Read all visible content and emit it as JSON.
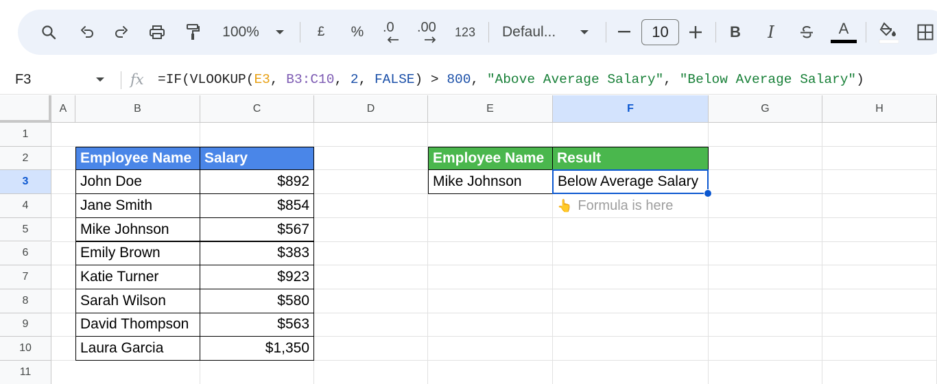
{
  "toolbar": {
    "zoom": "100%",
    "currency_label": "£",
    "percent_label": "%",
    "decrease_decimal_label": ".0",
    "increase_decimal_label": ".00",
    "more_formats_label": "123",
    "font_name": "Defaul...",
    "font_size": "10",
    "bold_label": "B",
    "italic_label": "I",
    "text_color_label": "A",
    "icons": [
      "search-icon",
      "undo-icon",
      "redo-icon",
      "print-icon",
      "paint-format-icon",
      "zoom-dropdown-icon",
      "font-dropdown-icon",
      "decrease-font-icon",
      "increase-font-icon",
      "strikethrough-icon",
      "fill-color-icon",
      "borders-icon"
    ]
  },
  "formula_bar": {
    "name_box": "F3",
    "fx_label": "fx",
    "tokens": [
      {
        "text": "=IF(VLOOKUP(",
        "kind": "plain"
      },
      {
        "text": "E3",
        "kind": "ref1"
      },
      {
        "text": ", ",
        "kind": "plain"
      },
      {
        "text": "B3:C10",
        "kind": "ref2"
      },
      {
        "text": ", ",
        "kind": "plain"
      },
      {
        "text": "2",
        "kind": "num"
      },
      {
        "text": ", ",
        "kind": "plain"
      },
      {
        "text": "FALSE",
        "kind": "num"
      },
      {
        "text": ") > ",
        "kind": "plain"
      },
      {
        "text": "800",
        "kind": "num"
      },
      {
        "text": ", ",
        "kind": "plain"
      },
      {
        "text": "\"Above Average Salary\"",
        "kind": "str"
      },
      {
        "text": ", ",
        "kind": "plain"
      },
      {
        "text": "\"Below Average Salary\"",
        "kind": "str"
      },
      {
        "text": ")",
        "kind": "plain"
      }
    ]
  },
  "grid": {
    "columns": [
      "A",
      "B",
      "C",
      "D",
      "E",
      "F",
      "G",
      "H"
    ],
    "active_column": "F",
    "rows": [
      "1",
      "2",
      "3",
      "4",
      "5",
      "6",
      "7",
      "8",
      "9",
      "10",
      "11"
    ],
    "active_row": "3"
  },
  "employee_table": {
    "headers": [
      "Employee Name",
      "Salary"
    ],
    "rows": [
      [
        "John Doe",
        "$892"
      ],
      [
        "Jane Smith",
        "$854"
      ],
      [
        "Mike Johnson",
        "$567"
      ],
      [
        "Emily Brown",
        "$383"
      ],
      [
        "Katie Turner",
        "$923"
      ],
      [
        "Sarah Wilson",
        "$580"
      ],
      [
        "David Thompson",
        "$563"
      ],
      [
        "Laura Garcia",
        "$1,350"
      ]
    ]
  },
  "lookup_table": {
    "headers": [
      "Employee Name",
      "Result"
    ],
    "employee_name": "Mike Johnson",
    "result": "Below Average Salary"
  },
  "note": {
    "emoji": "👆",
    "text": "Formula is here"
  },
  "colors": {
    "header_blue": "#4a86e8",
    "header_green": "#4ab74d",
    "selection": "#0b57d0"
  }
}
